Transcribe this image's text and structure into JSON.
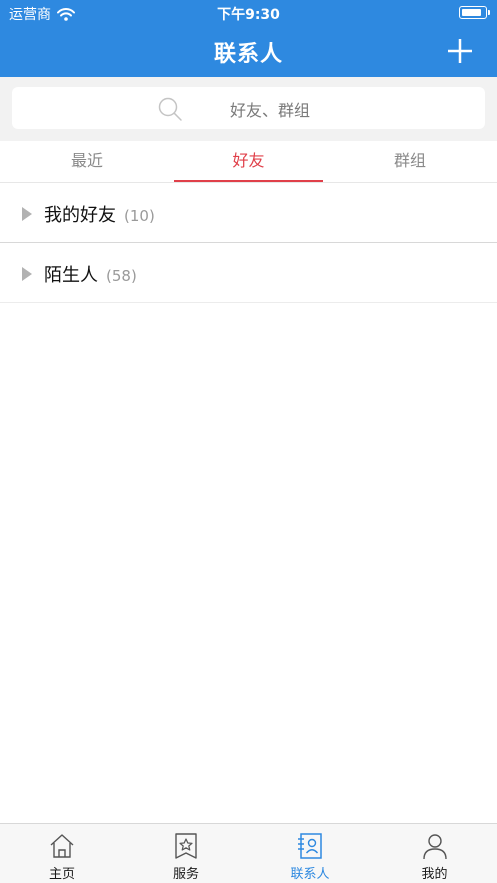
{
  "status_bar": {
    "carrier": "运营商",
    "time": "下午9:30",
    "battery_level": 0.9
  },
  "nav": {
    "title": "联系人",
    "add_icon": "plus-icon"
  },
  "search": {
    "placeholder": "好友、群组",
    "icon": "search-icon"
  },
  "tabs": [
    {
      "label": "最近",
      "active": false
    },
    {
      "label": "好友",
      "active": true
    },
    {
      "label": "群组",
      "active": false
    }
  ],
  "groups": [
    {
      "name": "我的好友",
      "count": "(10)",
      "expanded": false
    },
    {
      "name": "陌生人",
      "count": "(58)",
      "expanded": false
    }
  ],
  "tabbar": [
    {
      "label": "主页",
      "icon": "home-icon",
      "active": false
    },
    {
      "label": "服务",
      "icon": "star-badge-icon",
      "active": false
    },
    {
      "label": "联系人",
      "icon": "contacts-icon",
      "active": true
    },
    {
      "label": "我的",
      "icon": "person-icon",
      "active": false
    }
  ],
  "colors": {
    "primary": "#2e89e0",
    "tab_active": "#e0404a"
  }
}
